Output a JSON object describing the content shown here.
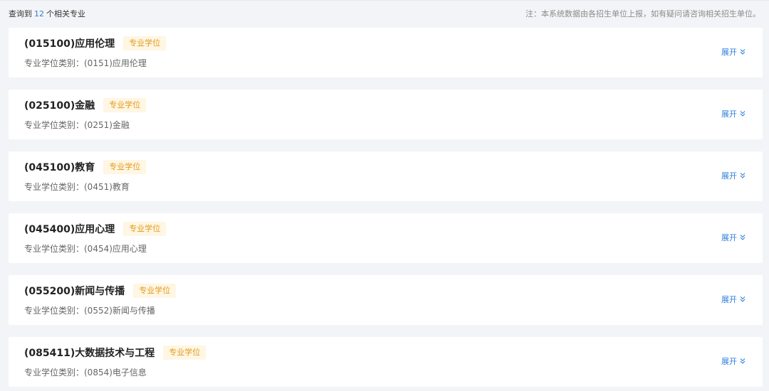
{
  "summary": {
    "prefix": "查询到",
    "count": "12",
    "suffix": "个相关专业",
    "note": "注：本系统数据由各招生单位上报，如有疑问请咨询相关招生单位。"
  },
  "majors": [
    {
      "title": "(015100)应用伦理",
      "badge": "专业学位",
      "subtitle": "专业学位类别：(0151)应用伦理",
      "expand_label": "展开"
    },
    {
      "title": "(025100)金融",
      "badge": "专业学位",
      "subtitle": "专业学位类别：(0251)金融",
      "expand_label": "展开"
    },
    {
      "title": "(045100)教育",
      "badge": "专业学位",
      "subtitle": "专业学位类别：(0451)教育",
      "expand_label": "展开"
    },
    {
      "title": "(045400)应用心理",
      "badge": "专业学位",
      "subtitle": "专业学位类别：(0454)应用心理",
      "expand_label": "展开"
    },
    {
      "title": "(055200)新闻与传播",
      "badge": "专业学位",
      "subtitle": "专业学位类别：(0552)新闻与传播",
      "expand_label": "展开"
    },
    {
      "title": "(085411)大数据技术与工程",
      "badge": "专业学位",
      "subtitle": "专业学位类别：(0854)电子信息",
      "expand_label": "展开"
    }
  ],
  "colors": {
    "accent": "#2f7fdb",
    "badge_text": "#e29a1c",
    "badge_bg": "#fff6e3"
  },
  "icons": {
    "expand": "chevron-double-down-icon"
  }
}
